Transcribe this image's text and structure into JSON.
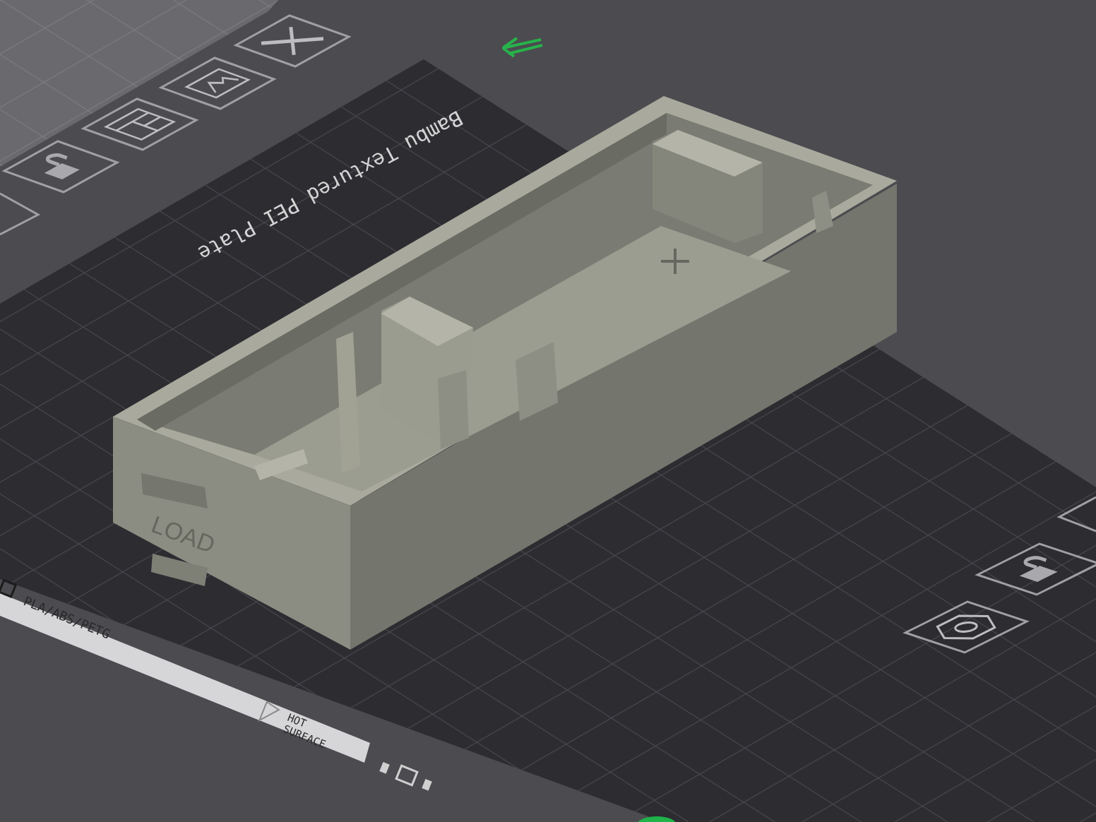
{
  "plate": {
    "name": "Bambu Textured PEI Plate",
    "filament_label": "PLA/ABS/PETG",
    "warning_lines": [
      "HOT",
      "SURFACE"
    ]
  },
  "model": {
    "label": "LOAD"
  }
}
